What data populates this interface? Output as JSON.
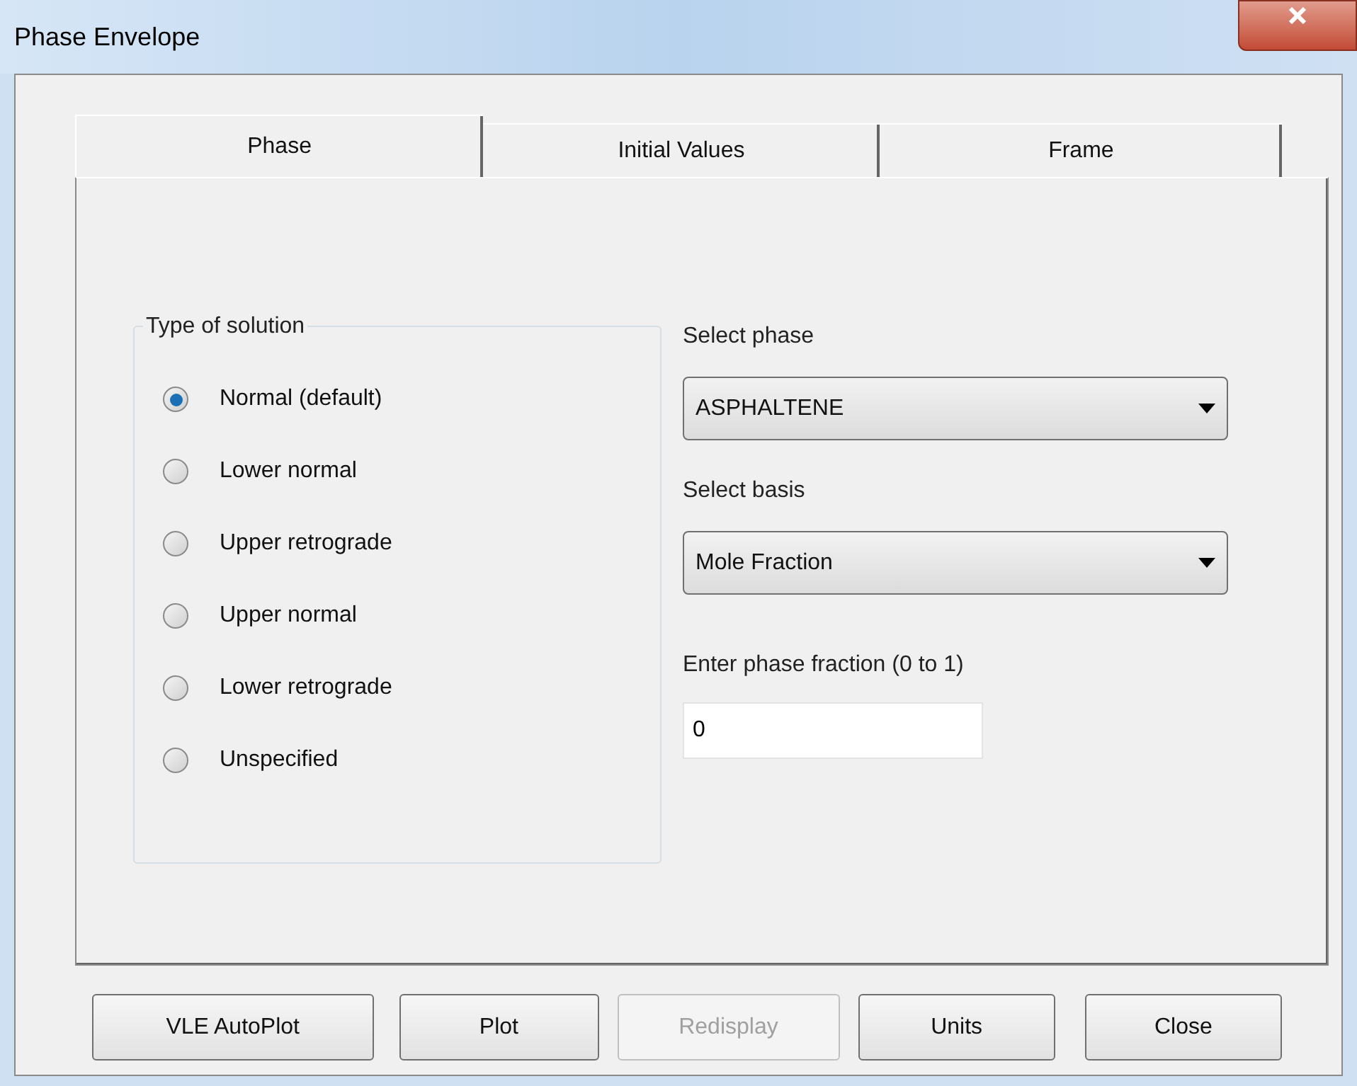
{
  "window": {
    "title": "Phase Envelope"
  },
  "tabs": [
    {
      "label": "Phase",
      "selected": true
    },
    {
      "label": "Initial Values",
      "selected": false
    },
    {
      "label": "Frame",
      "selected": false
    }
  ],
  "solution_group": {
    "title": "Type of solution",
    "options": [
      {
        "label": "Normal (default)",
        "selected": true
      },
      {
        "label": "Lower normal",
        "selected": false
      },
      {
        "label": "Upper retrograde",
        "selected": false
      },
      {
        "label": "Upper normal",
        "selected": false
      },
      {
        "label": "Lower retrograde",
        "selected": false
      },
      {
        "label": "Unspecified",
        "selected": false
      }
    ]
  },
  "phase_select": {
    "label": "Select phase",
    "value": "ASPHALTENE"
  },
  "basis_select": {
    "label": "Select basis",
    "value": "Mole Fraction"
  },
  "phase_fraction": {
    "label": "Enter phase fraction (0 to 1)",
    "value": "0"
  },
  "buttons": [
    {
      "label": "VLE AutoPlot",
      "disabled": false
    },
    {
      "label": "Plot",
      "disabled": false
    },
    {
      "label": "Redisplay",
      "disabled": true
    },
    {
      "label": "Units",
      "disabled": false
    },
    {
      "label": "Close",
      "disabled": false
    }
  ]
}
